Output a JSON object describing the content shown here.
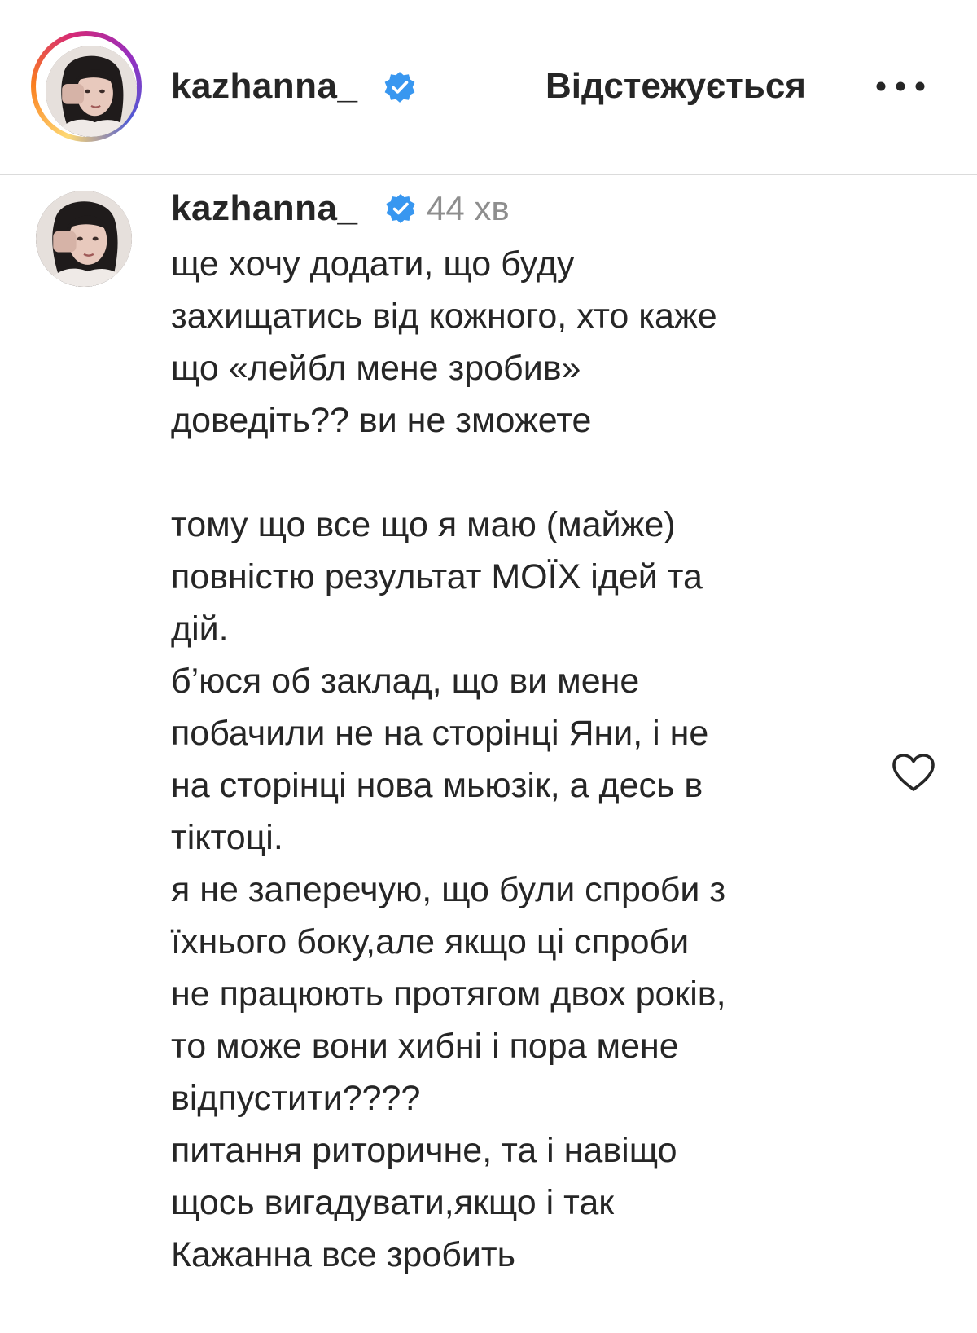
{
  "header": {
    "username": "kazhanna_",
    "follow_status": "Відстежується",
    "verified_icon": "verified-badge-icon",
    "more_icon": "more-horizontal-icon",
    "accent_color": "#3897f0"
  },
  "comment": {
    "username": "kazhanna_",
    "time": "44 хв",
    "lines": [
      "ще хочу додати, що буду",
      "захищатись від кожного, хто каже",
      "що «лейбл мене зробив»",
      "доведіть?? ви не зможете",
      "",
      "тому що все що я маю (майже)",
      "повністю результат МОЇХ ідей та",
      "дій.",
      "б’юся об заклад, що ви мене",
      "побачили не на сторінці Яни, і не",
      "на сторінці нова мьюзік, а десь в",
      "тіктоці.",
      "я не заперечую, що були спроби з",
      "їхнього боку,але якщо ці спроби",
      "не працюють протягом двох років,",
      "то може вони хибні і пора мене",
      "відпустити????",
      "питання риторичне, та і навіщо",
      "щось вигадувати,якщо і так",
      "Кажанна все зробить"
    ],
    "like_icon": "heart-outline-icon"
  }
}
